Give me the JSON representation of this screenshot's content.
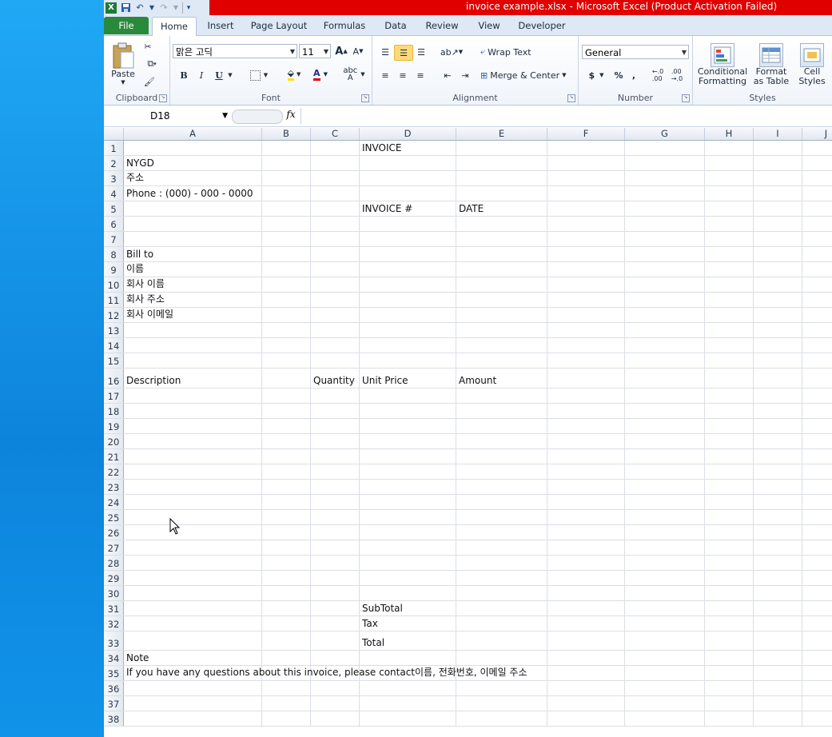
{
  "window": {
    "title": "invoice example.xlsx  -  Microsoft Excel (Product Activation Failed)"
  },
  "ribbon_tabs": [
    "File",
    "Home",
    "Insert",
    "Page Layout",
    "Formulas",
    "Data",
    "Review",
    "View",
    "Developer"
  ],
  "active_tab": "Home",
  "ribbon": {
    "clipboard": {
      "label": "Clipboard",
      "paste": "Paste"
    },
    "font": {
      "label": "Font",
      "name": "맑은 고딕",
      "size": "11",
      "bold": "B",
      "italic": "I",
      "underline": "U"
    },
    "alignment": {
      "label": "Alignment",
      "wrap_text": "Wrap Text",
      "merge_center": "Merge & Center"
    },
    "number": {
      "label": "Number",
      "format": "General",
      "currency": "$",
      "percent": "%",
      "comma": ","
    },
    "styles": {
      "label": "Styles",
      "conditional": [
        "Conditional",
        "Formatting"
      ],
      "format_table": [
        "Format",
        "as Table"
      ],
      "cell_styles": [
        "Cell",
        "Styles"
      ]
    }
  },
  "formula_bar": {
    "name_box": "D18",
    "fx": "fx",
    "content": ""
  },
  "columns": [
    "A",
    "B",
    "C",
    "D",
    "E",
    "F",
    "G",
    "H",
    "I",
    "J"
  ],
  "row_numbers": [
    "1",
    "2",
    "3",
    "4",
    "5",
    "6",
    "7",
    "8",
    "9",
    "10",
    "11",
    "12",
    "13",
    "14",
    "15",
    "16",
    "17",
    "18",
    "19",
    "20",
    "21",
    "22",
    "23",
    "24",
    "25",
    "26",
    "27",
    "28",
    "29",
    "30",
    "31",
    "32",
    "33",
    "34",
    "35",
    "36",
    "37",
    "38"
  ],
  "cells": {
    "D1": "INVOICE",
    "A2": "NYGD",
    "A3": "주소",
    "A4": "Phone : (000) - 000 - 0000",
    "D5": "INVOICE #",
    "E5": "DATE",
    "A8": "Bill to",
    "A9": "이름",
    "A10": "회사 이름",
    "A11": "회사 주소",
    "A12": "회사 이메일",
    "A16": "Description",
    "C16": "Quantity",
    "D16": "Unit Price",
    "E16": "Amount",
    "D31": "SubTotal",
    "D32": "Tax",
    "D33": "Total",
    "A34": "Note",
    "A35": "If you have any questions about this invoice, please contact이름, 전화번호, 이메일 주소"
  },
  "colors": {
    "title_bar": "#e00000",
    "file_tab": "#2a8a3c",
    "desktop": "#1093e8"
  }
}
